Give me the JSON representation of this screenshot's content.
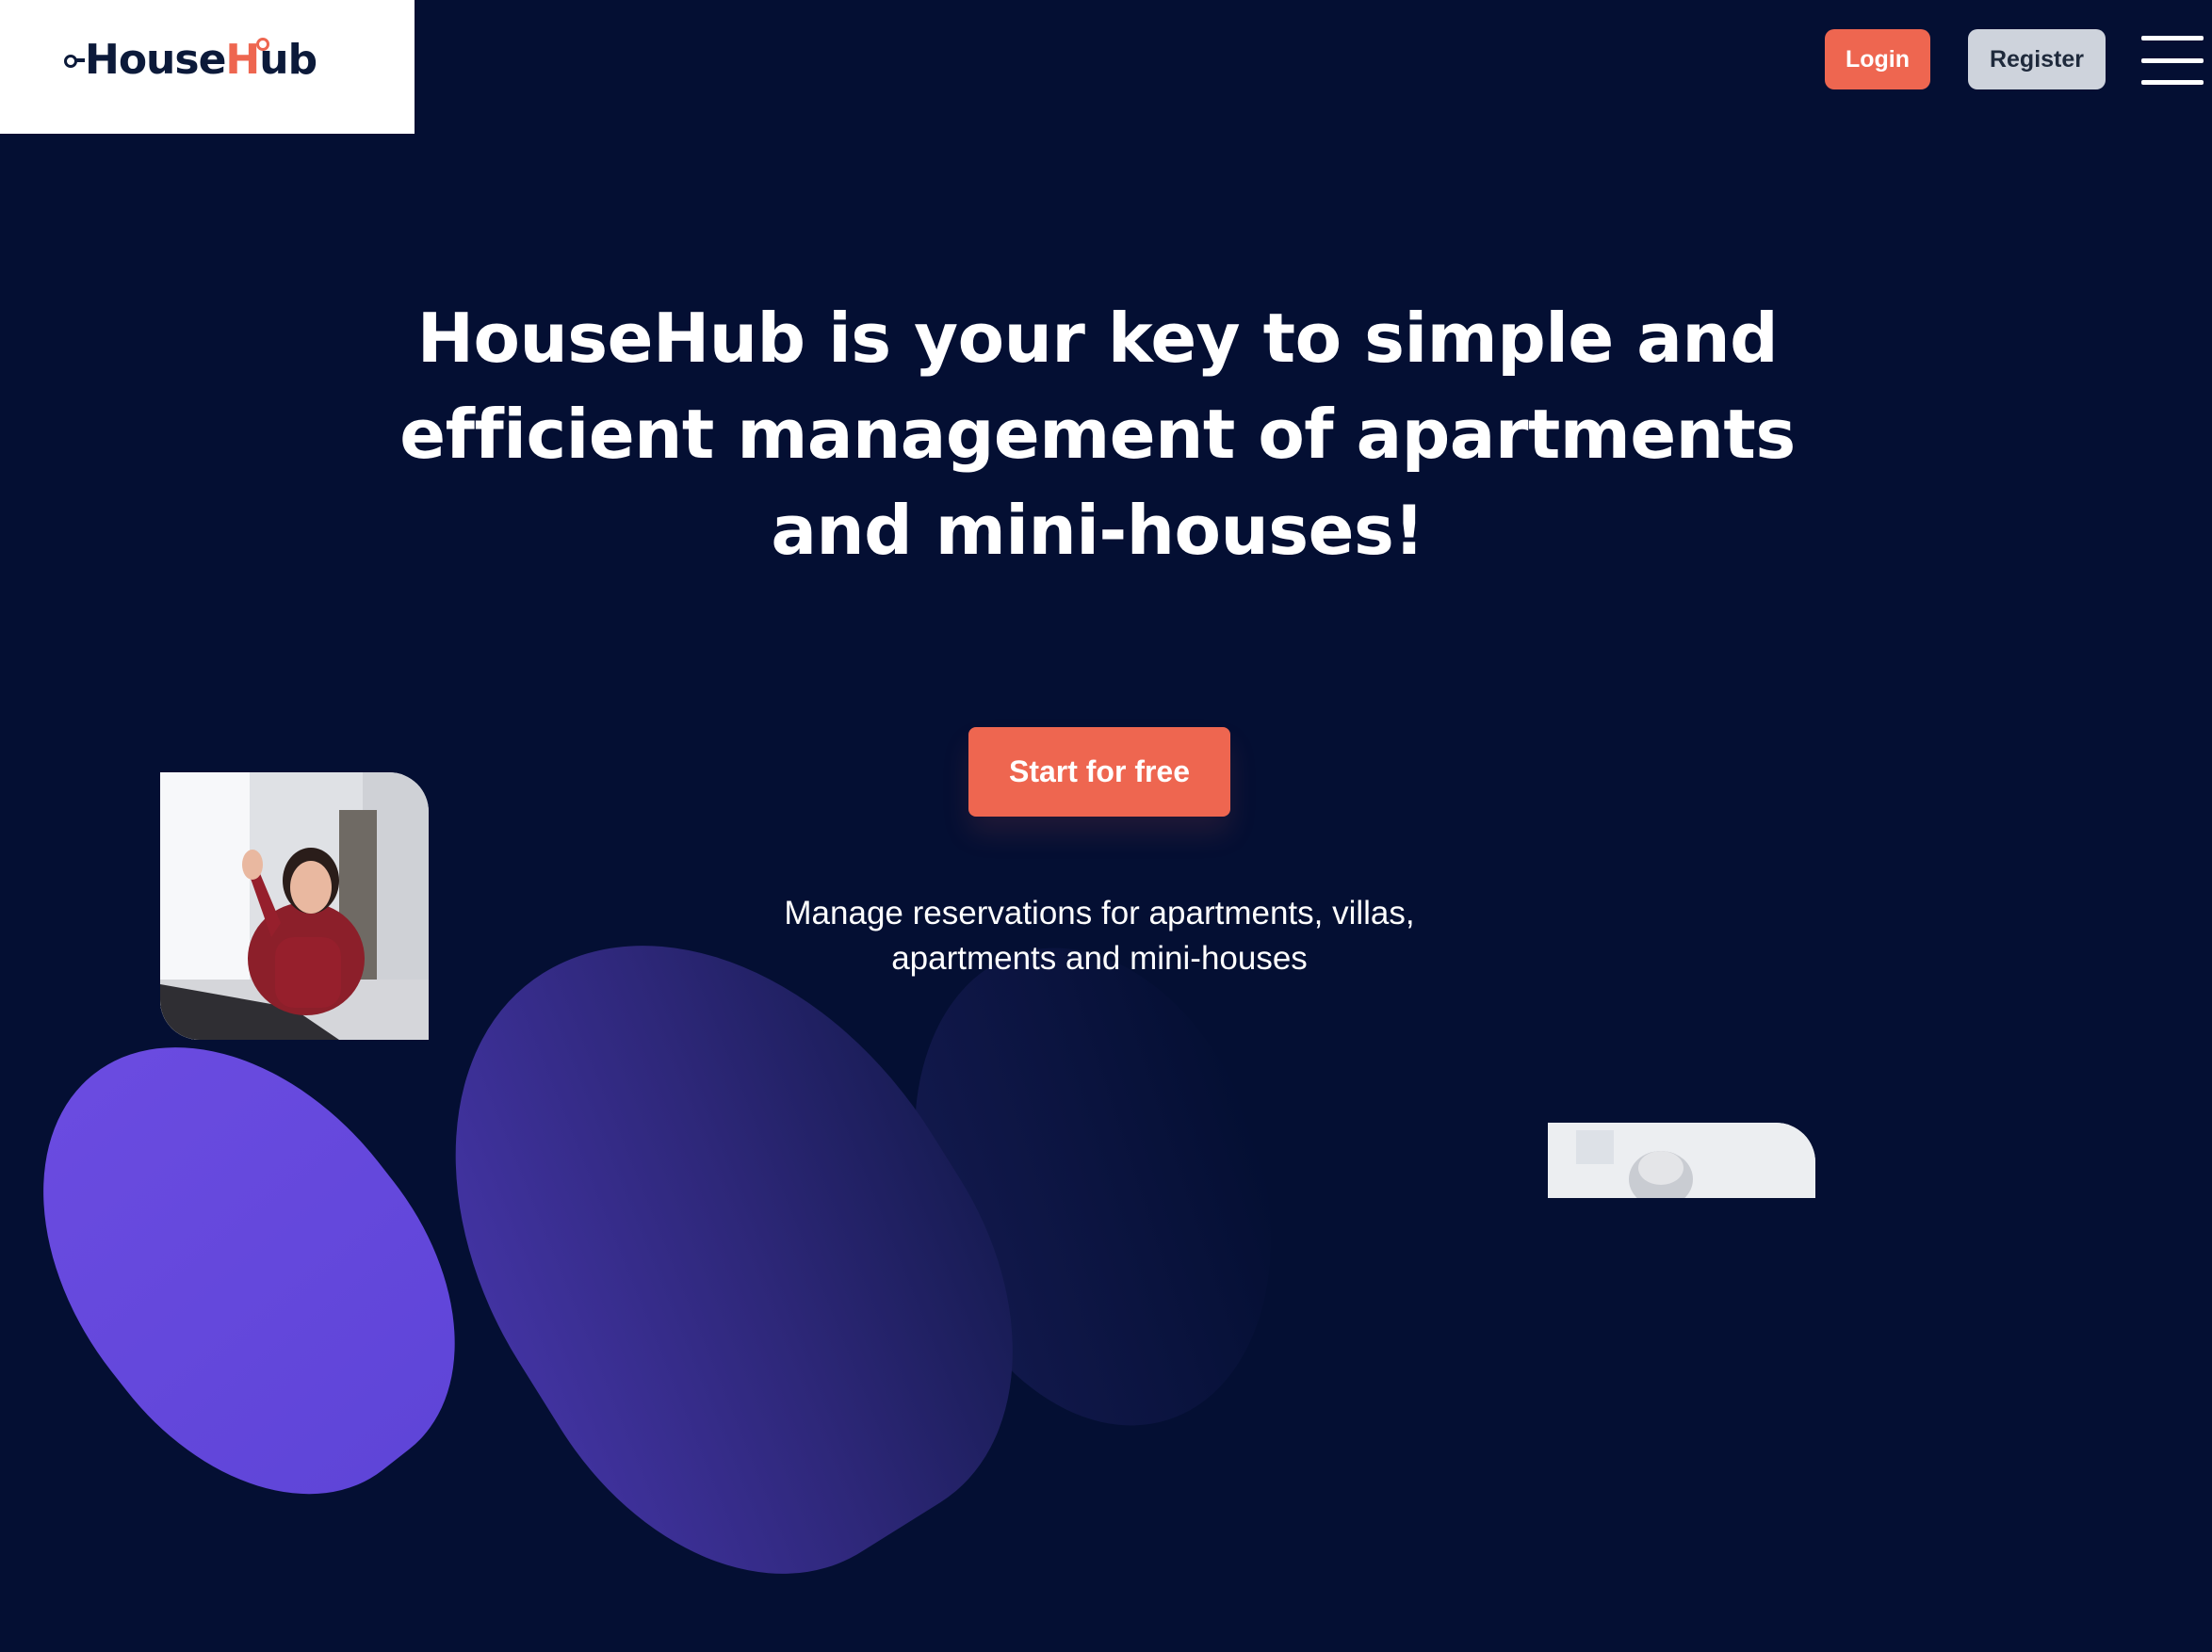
{
  "brand": {
    "name_prefix": "House",
    "name_h": "H",
    "name_suffix": "ub",
    "colors": {
      "accent": "#ee6650",
      "navy": "#040f33",
      "logo_text": "#0c1a3a",
      "purple": "#6a4be0"
    }
  },
  "header": {
    "login_label": "Login",
    "register_label": "Register",
    "menu_icon": "hamburger-icon"
  },
  "hero": {
    "title": "HouseHub is your key to simple and efficient management of apartments and mini-houses!",
    "cta_label": "Start for free",
    "subtitle": "Manage reservations for apartments, villas, apartments and mini-houses"
  }
}
